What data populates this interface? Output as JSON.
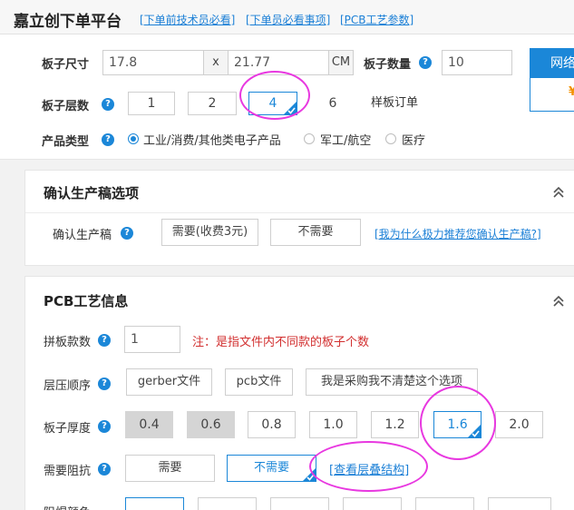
{
  "header": {
    "title": "嘉立创下单平台",
    "links": [
      "[下单前技术员必看]",
      "[下单员必看事项]",
      "[PCB工艺参数]"
    ]
  },
  "board": {
    "size_label": "板子尺寸",
    "width": "17.8",
    "times": "x",
    "height": "21.77",
    "unit": "CM",
    "qty_label": "板子数量",
    "qty": "10",
    "layers_label": "板子层数",
    "layers": [
      "1",
      "2",
      "4",
      "6"
    ],
    "layers_selected": "4",
    "sample_order": "样板订单",
    "type_label": "产品类型",
    "types": [
      "工业/消费/其他类电子产品",
      "军工/航空",
      "医疗"
    ],
    "type_selected": "工业/消费/其他类电子产品"
  },
  "side_card": {
    "title": "网络",
    "mark": "¥"
  },
  "confirm": {
    "title": "确认生产稿选项",
    "row_label": "确认生产稿",
    "options": [
      "需要(收费3元)",
      "不需要"
    ],
    "why_link": "[我为什么极力推荐您确认生产稿?]"
  },
  "pcb": {
    "title": "PCB工艺信息",
    "panel_label": "拼板款数",
    "panel_value": "1",
    "panel_note": "注：是指文件内不同款的板子个数",
    "stack_label": "层压顺序",
    "stack_options": [
      "gerber文件",
      "pcb文件",
      "我是采购我不清楚这个选项"
    ],
    "thick_label": "板子厚度",
    "thick_options": [
      "0.4",
      "0.6",
      "0.8",
      "1.0",
      "1.2",
      "1.6",
      "2.0"
    ],
    "thick_selected": "1.6",
    "imp_label": "需要阻抗",
    "imp_options": [
      "需要",
      "不需要"
    ],
    "imp_selected": "不需要",
    "imp_link": "[查看层叠结构]",
    "mask_label": "阻焊颜色"
  },
  "colors": {
    "accent": "#1b87d8",
    "highlight": "#e838e0",
    "note": "#d23030"
  }
}
